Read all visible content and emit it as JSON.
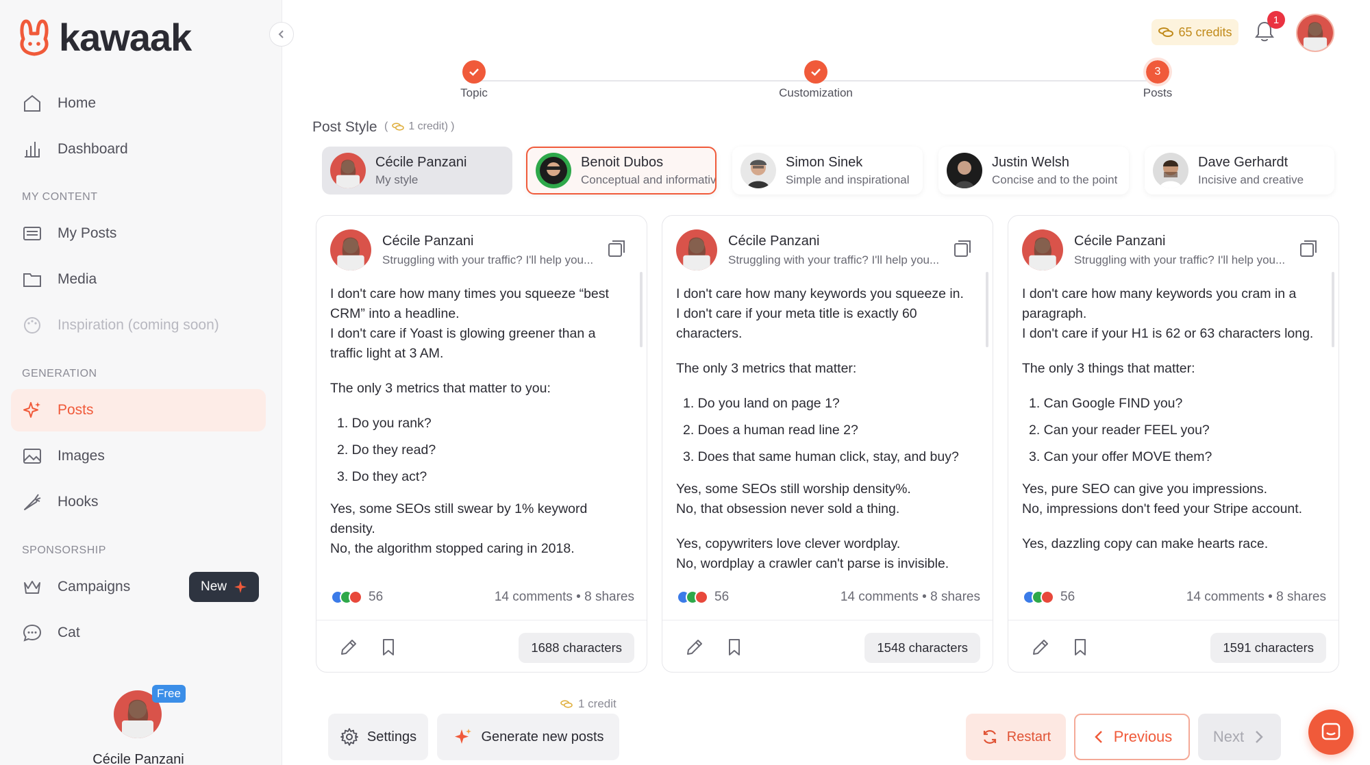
{
  "app": {
    "name": "kawaak"
  },
  "sidebar": {
    "nav": [
      {
        "label": "Home",
        "icon": "home-icon"
      },
      {
        "label": "Dashboard",
        "icon": "chart-icon"
      }
    ],
    "sections": {
      "my_content": "MY CONTENT",
      "generation": "GENERATION",
      "sponsorship": "SPONSORSHIP"
    },
    "my_content": [
      {
        "label": "My Posts"
      },
      {
        "label": "Media"
      },
      {
        "label": "Inspiration (coming soon)"
      }
    ],
    "generation": [
      {
        "label": "Posts"
      },
      {
        "label": "Images"
      },
      {
        "label": "Hooks"
      }
    ],
    "sponsorship": [
      {
        "label": "Campaigns",
        "badge": "New"
      },
      {
        "label": "Cat"
      }
    ],
    "profile": {
      "name": "Cécile Panzani",
      "plan": "Free"
    }
  },
  "topbar": {
    "credits": "65 credits",
    "notifications": "1"
  },
  "stepper": [
    {
      "label": "Topic",
      "state": "done"
    },
    {
      "label": "Customization",
      "state": "done"
    },
    {
      "label": "Posts",
      "state": "current",
      "number": "3"
    }
  ],
  "post_style": {
    "title": "Post Style",
    "credit_open": "(",
    "credit": "1 credit)",
    "credit_close": ")",
    "styles": [
      {
        "name": "Cécile Panzani",
        "desc": "My style"
      },
      {
        "name": "Benoit Dubos",
        "desc": "Conceptual and informative"
      },
      {
        "name": "Simon Sinek",
        "desc": "Simple and inspirational"
      },
      {
        "name": "Justin Welsh",
        "desc": "Concise and to the point"
      },
      {
        "name": "Dave Gerhardt",
        "desc": "Incisive and creative"
      }
    ]
  },
  "posts": [
    {
      "author": "Cécile Panzani",
      "headline": "Struggling with your traffic? I'll help you...",
      "p1": "I don't care how many times you squeeze “best CRM” into a headline.\nI don't care if Yoast is glowing greener than a traffic light at 3 AM.",
      "p2": "The only 3 metrics that matter to you:",
      "list": [
        "1. Do you rank?",
        "2. Do they read?",
        "3. Do they act?"
      ],
      "p3": "Yes, some SEOs still swear by 1% keyword density.\nNo, the algorithm stopped caring in 2018.",
      "reactions": "56",
      "comments": "14 comments",
      "shares": "8 shares",
      "characters": "1688 characters"
    },
    {
      "author": "Cécile Panzani",
      "headline": "Struggling with your traffic? I'll help you...",
      "p1": "I don't care how many keywords you squeeze in.\nI don't care if your meta title is exactly 60 characters.",
      "p2": "The only 3 metrics that matter:",
      "list": [
        "1. Do you land on page 1?",
        "2. Does a human read line 2?",
        "3. Does that same human click, stay, and buy?"
      ],
      "p3": "Yes, some SEOs still worship density%.\nNo, that obsession never sold a thing.",
      "p4": "Yes, copywriters love clever wordplay.\nNo, wordplay a crawler can't parse is invisible.",
      "reactions": "56",
      "comments": "14 comments",
      "shares": "8 shares",
      "characters": "1548 characters"
    },
    {
      "author": "Cécile Panzani",
      "headline": "Struggling with your traffic? I'll help you...",
      "p1": "I don't care how many keywords you cram in a paragraph.\nI don't care if your H1 is 62 or 63 characters long.",
      "p2": "The only 3 things that matter:",
      "list": [
        "1. Can Google FIND you?",
        "2. Can your reader FEEL you?",
        "3. Can your offer MOVE them?"
      ],
      "p3": "Yes, pure SEO can give you impressions.\nNo, impressions don't feed your Stripe account.",
      "p4": "Yes, dazzling copy can make hearts race.",
      "reactions": "56",
      "comments": "14 comments",
      "shares": "8 shares",
      "characters": "1591 characters"
    }
  ],
  "actions": {
    "settings": "Settings",
    "generate": "Generate new posts",
    "generate_credit": "1 credit",
    "restart": "Restart",
    "previous": "Previous",
    "next": "Next"
  },
  "colors": {
    "accent": "#f05a3a",
    "dark": "#2e3440",
    "credit": "#c08a1a"
  }
}
